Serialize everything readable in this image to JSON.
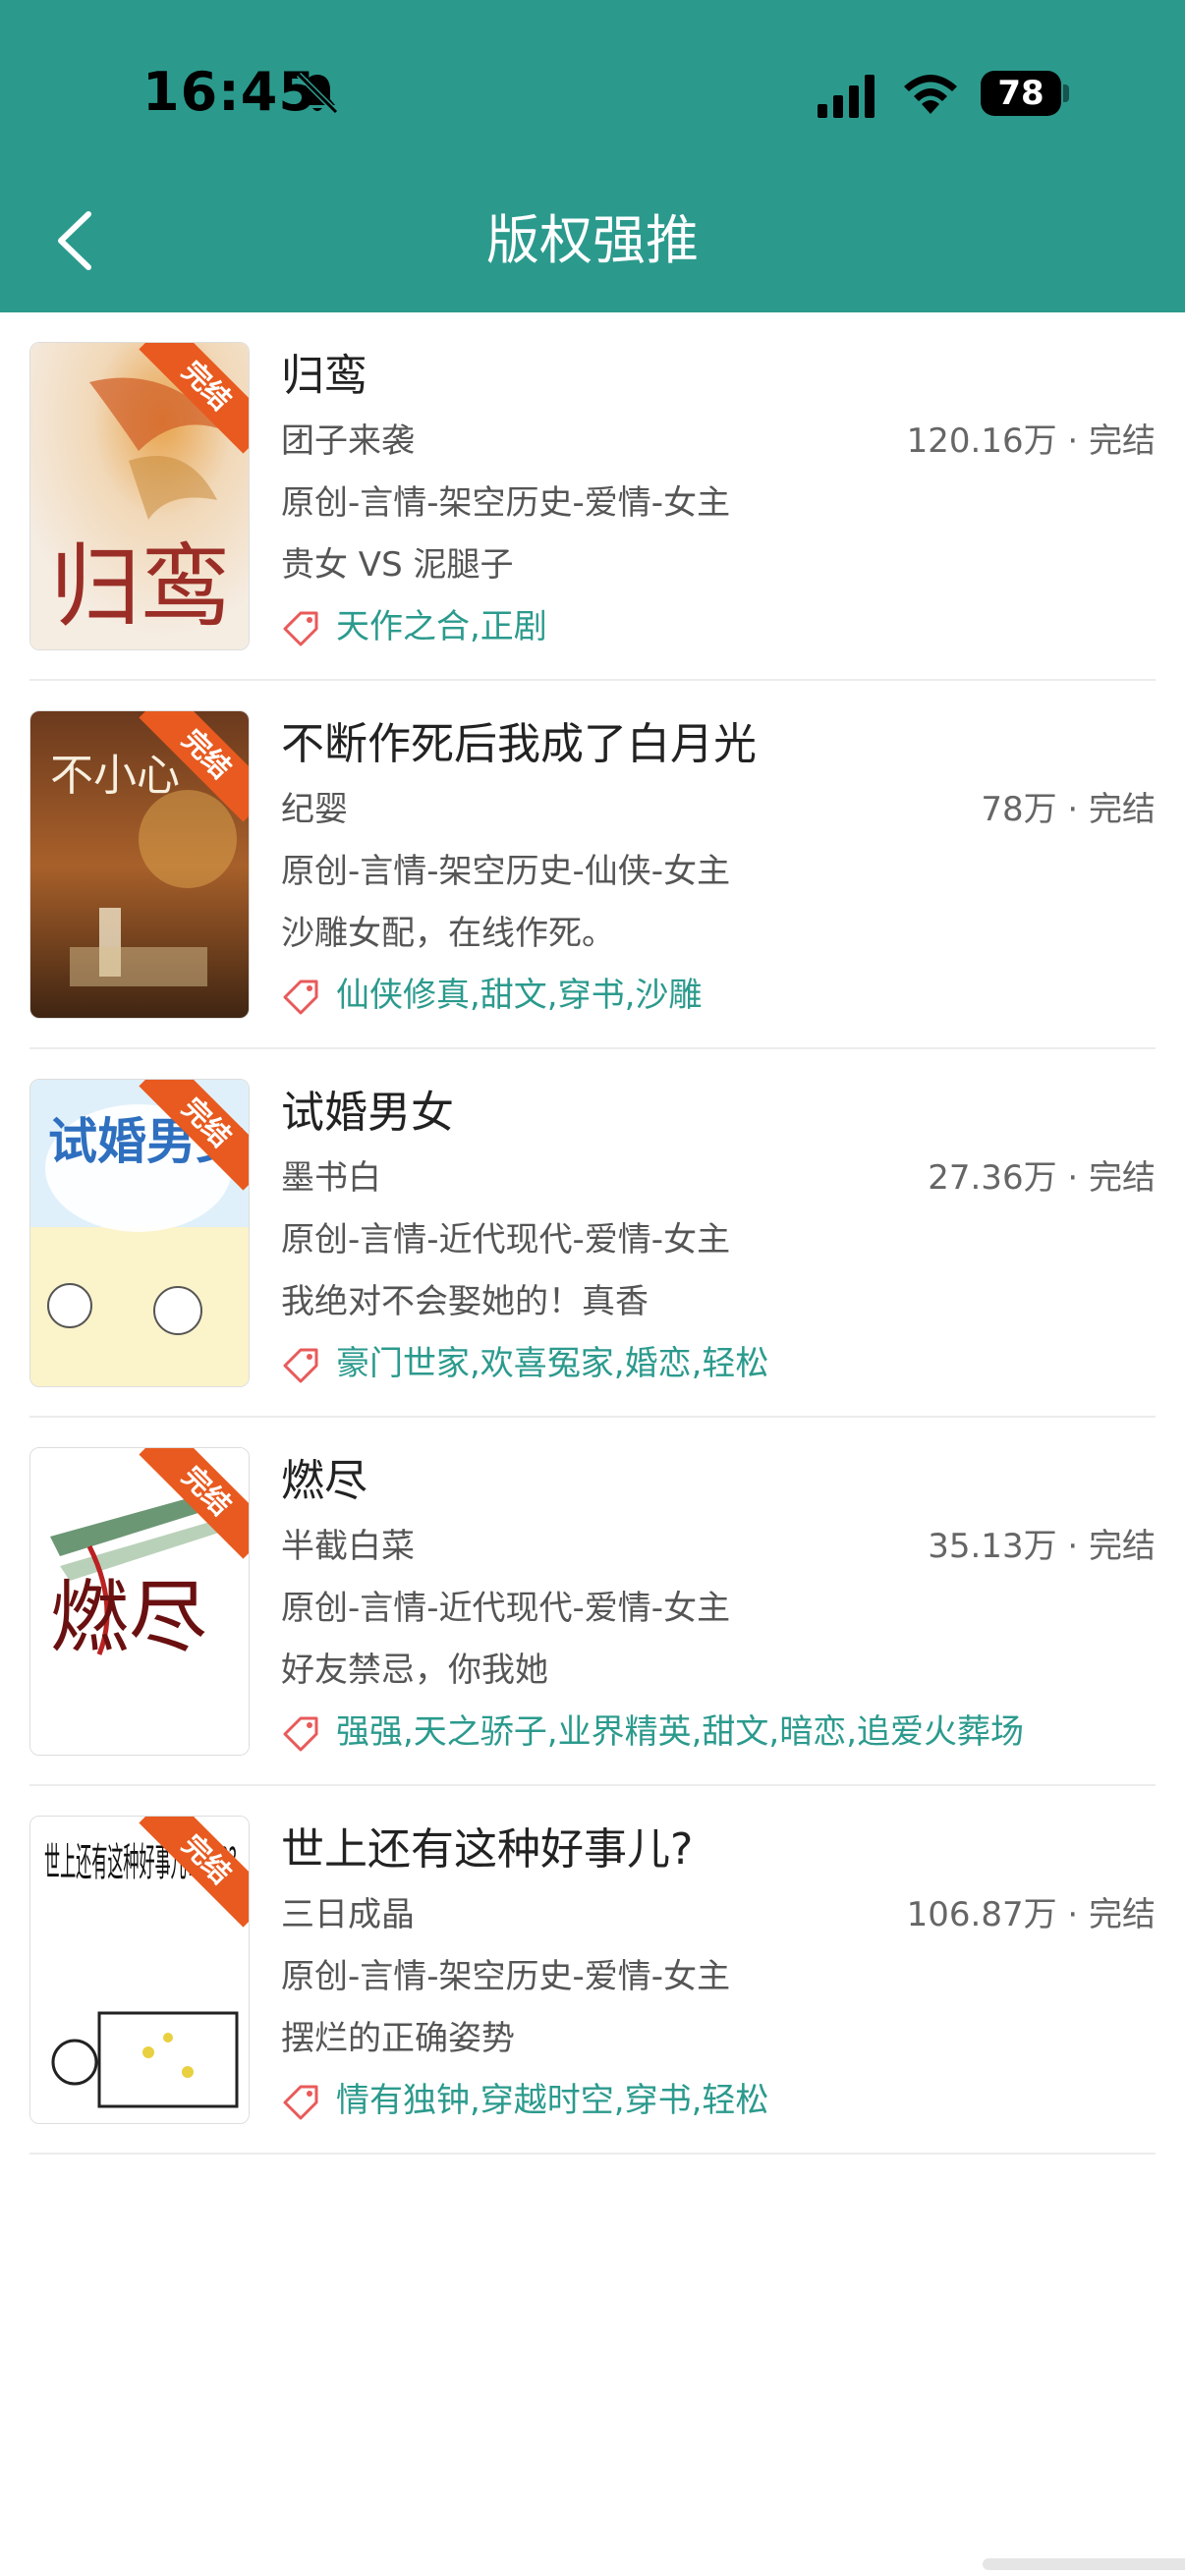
{
  "status_bar": {
    "time": "16:45",
    "battery": "78"
  },
  "nav": {
    "title": "版权强推"
  },
  "books": [
    {
      "title": "归鸾",
      "author": "团子来袭",
      "stats": "120.16万 · 完结",
      "genre": "原创-言情-架空历史-爱情-女主",
      "tagline": "贵女 VS 泥腿子",
      "tags": "天作之合,正剧",
      "badge": "完结",
      "cover_text": "归鸾"
    },
    {
      "title": "不断作死后我成了白月光",
      "author": "纪婴",
      "stats": "78万 · 完结",
      "genre": "原创-言情-架空历史-仙侠-女主",
      "tagline": "沙雕女配，在线作死。",
      "tags": "仙侠修真,甜文,穿书,沙雕",
      "badge": "完结",
      "cover_text": "不小心"
    },
    {
      "title": "试婚男女",
      "author": "墨书白",
      "stats": "27.36万 · 完结",
      "genre": "原创-言情-近代现代-爱情-女主",
      "tagline": "我绝对不会娶她的！真香",
      "tags": "豪门世家,欢喜冤家,婚恋,轻松",
      "badge": "完结",
      "cover_text": "试婚男女"
    },
    {
      "title": "燃尽",
      "author": "半截白菜",
      "stats": "35.13万 · 完结",
      "genre": "原创-言情-近代现代-爱情-女主",
      "tagline": "好友禁忌，你我她",
      "tags": "强强,天之骄子,业界精英,甜文,暗恋,追爱火葬场",
      "badge": "完结",
      "cover_text": "燃尽"
    },
    {
      "title": "世上还有这种好事儿?",
      "author": "三日成晶",
      "stats": "106.87万 · 完结",
      "genre": "原创-言情-架空历史-爱情-女主",
      "tagline": "摆烂的正确姿势",
      "tags": "情有独钟,穿越时空,穿书,轻松",
      "badge": "完结",
      "cover_text": "世上还有这种好事儿??????"
    }
  ],
  "colors": {
    "header": "#2b9a8d",
    "tag_text": "#2b9a8d",
    "badge": "#e85a1f",
    "tag_icon": "#e85a5a"
  },
  "icons": [
    "bell-off-icon",
    "signal-icon",
    "wifi-icon",
    "battery-icon",
    "back-arrow-icon",
    "tag-icon"
  ]
}
